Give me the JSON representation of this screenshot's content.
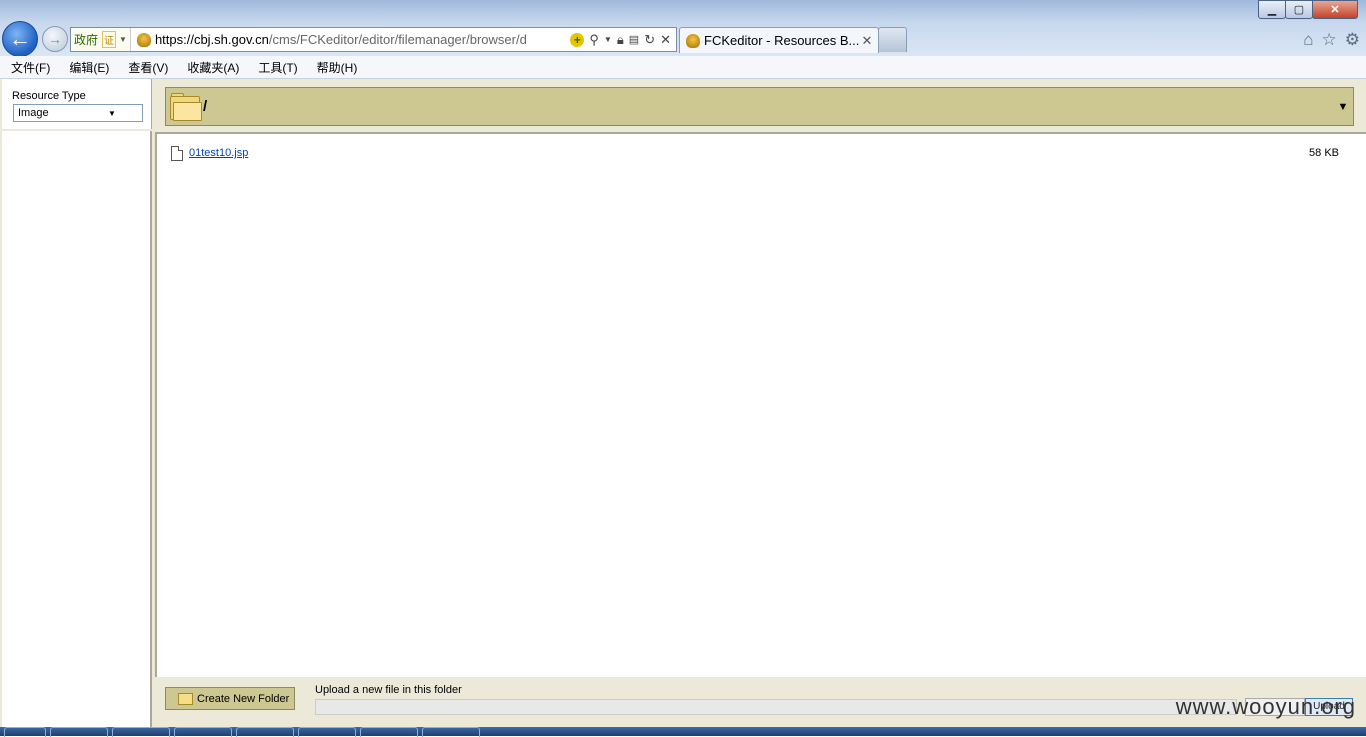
{
  "window": {
    "controls": {
      "minimize": "▁",
      "maximize": "▢",
      "close": "✕"
    }
  },
  "nav": {
    "back_icon": "←",
    "forward_icon": "→"
  },
  "address": {
    "gov_label": "政府",
    "cert_label": "证",
    "url_host": "https://cbj.sh.gov.cn",
    "url_path": "/cms/FCKeditor/editor/filemanager/browser/d"
  },
  "tab": {
    "title": "FCKeditor - Resources B...",
    "close": "✕"
  },
  "menu": {
    "items": [
      "文件(F)",
      "编辑(E)",
      "查看(V)",
      "收藏夹(A)",
      "工具(T)",
      "帮助(H)"
    ]
  },
  "browser": {
    "resource_type_label": "Resource Type",
    "resource_type_value": "Image",
    "current_path": "/",
    "files": [
      {
        "name": "01test10.jsp",
        "size": "58 KB"
      }
    ],
    "create_folder_label": "Create New Folder",
    "upload_label": "Upload a new file in this folder",
    "upload_button": "Upload"
  },
  "watermark": "www.wooyun.org"
}
